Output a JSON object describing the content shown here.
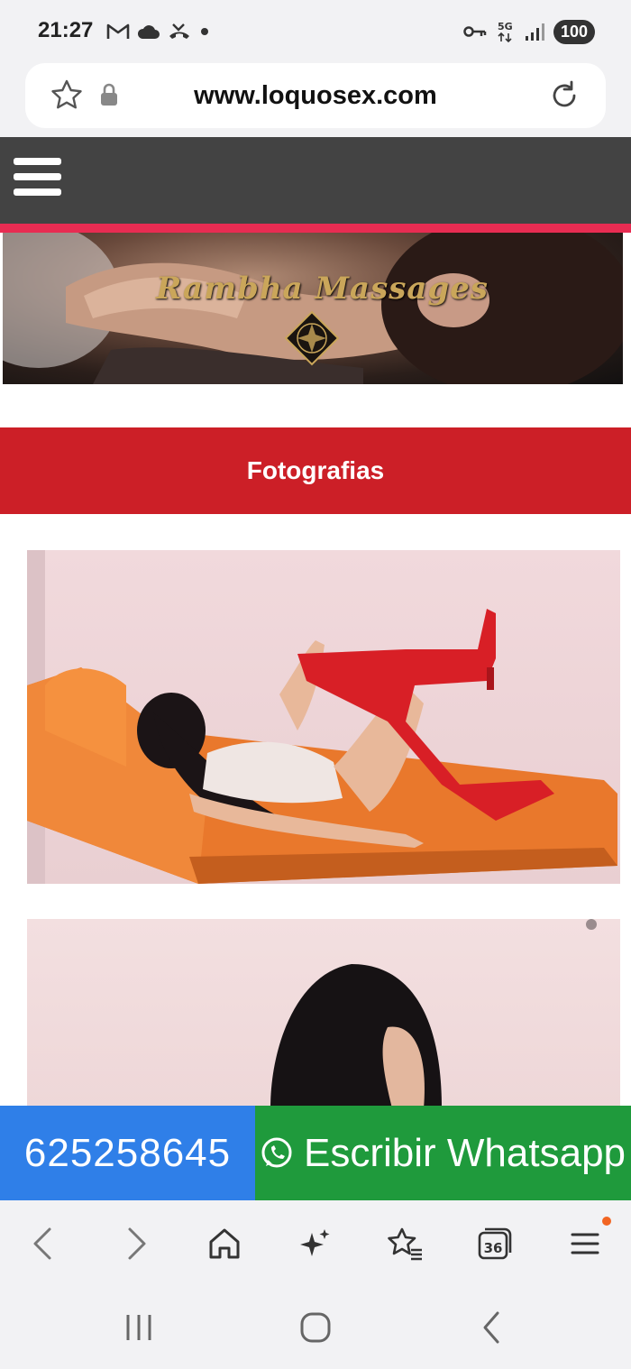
{
  "status_bar": {
    "time": "21:27",
    "network": "5G",
    "battery": "100",
    "icons_left": [
      "gmail-icon",
      "cloud-icon",
      "missed-call-icon",
      "dot-icon"
    ],
    "icons_right": [
      "vpn-key-icon",
      "network-5g-icon",
      "signal-icon",
      "battery-icon"
    ]
  },
  "browser": {
    "url": "www.loquosex.com",
    "tab_count": "36",
    "toolbar": [
      "back-icon",
      "forward-icon",
      "home-icon",
      "ai-sparkle-icon",
      "bookmarks-icon",
      "tabs-icon",
      "menu-icon"
    ]
  },
  "site": {
    "nav_color": "#434343",
    "accent_line_color": "#e82c52",
    "banner_title": "Rambha Massages",
    "section_title": "Fotografias",
    "section_color": "#cc1f27"
  },
  "contact": {
    "phone": "625258645",
    "whatsapp_label": "Escribir Whatsapp",
    "phone_color": "#2f7fe8",
    "whatsapp_color": "#1f9a3c"
  },
  "system_nav": [
    "recents-icon",
    "home-circle-icon",
    "back-chevron-icon"
  ]
}
